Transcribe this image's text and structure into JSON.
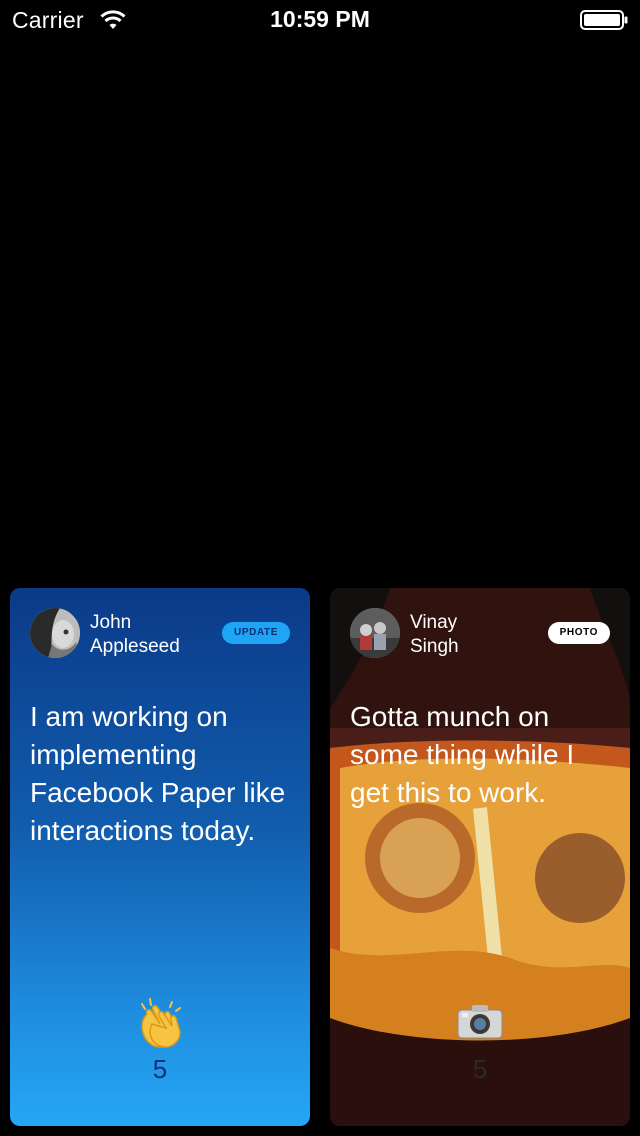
{
  "status_bar": {
    "carrier": "Carrier",
    "time": "10:59 PM",
    "wifi_icon": "wifi-icon",
    "battery_icon": "battery-icon"
  },
  "cards": [
    {
      "author_first": "John",
      "author_last": "Appleseed",
      "badge": "UPDATE",
      "text": "I am working on implementing Facebook Paper like interactions today.",
      "reaction_icon": "clapping-hands-icon",
      "count": "5",
      "accent": "#1ea5f6"
    },
    {
      "author_first": "Vinay",
      "author_last": "Singh",
      "badge": "PHOTO",
      "text": "Gotta munch on some thing while I get this to work.",
      "reaction_icon": "camera-icon",
      "count": "5"
    }
  ]
}
